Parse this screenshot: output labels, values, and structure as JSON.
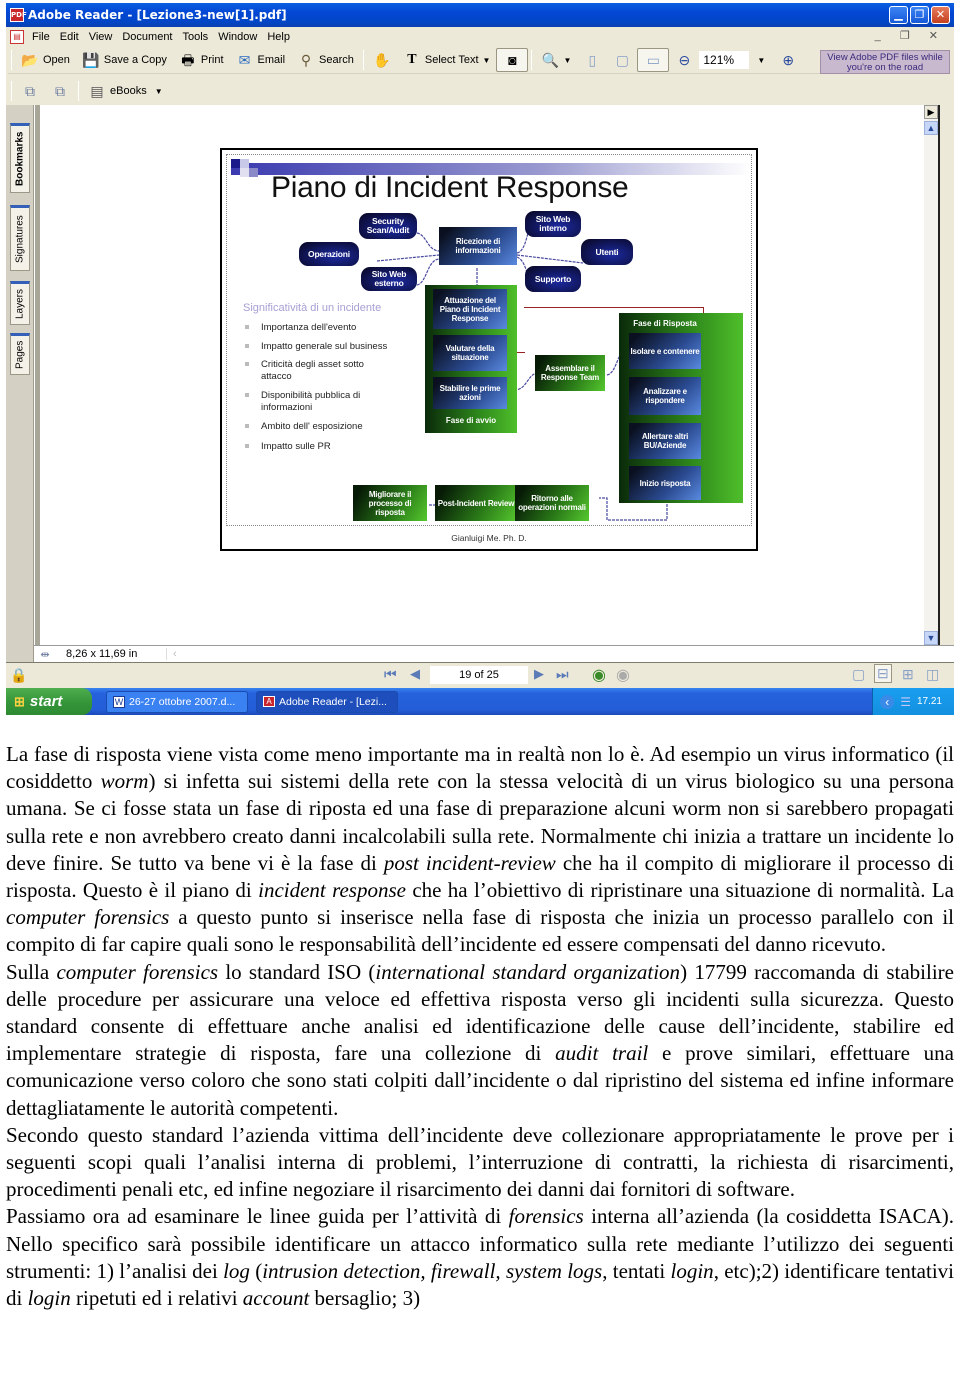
{
  "window": {
    "title": "Adobe Reader - [Lezione3-new[1].pdf]",
    "app_icon": "adobe-reader-icon",
    "controls": [
      "minimize",
      "restore",
      "close"
    ]
  },
  "menu": {
    "items": [
      "File",
      "Edit",
      "View",
      "Document",
      "Tools",
      "Window",
      "Help"
    ],
    "doc_controls": [
      "_",
      "❐",
      "✕"
    ]
  },
  "toolbar": {
    "open": "Open",
    "save_copy": "Save a Copy",
    "print": "Print",
    "email": "Email",
    "search": "Search",
    "select_text": "Select Text",
    "zoom_value": "121%",
    "ebooks": "eBooks",
    "promo": "View Adobe PDF files while you're on the road"
  },
  "nav_tabs": [
    "Bookmarks",
    "Signatures",
    "Layers",
    "Pages"
  ],
  "status": {
    "page_size": "8,26 x 11,69 in",
    "page_indicator": "19 of 25"
  },
  "taskbar": {
    "start": "start",
    "tasks": [
      {
        "label": "26-27 ottobre 2007.d...",
        "icon": "word-doc-icon",
        "active": false
      },
      {
        "label": "Adobe Reader - [Lezi...",
        "icon": "adobe-reader-icon",
        "active": true
      }
    ],
    "clock": "17.21"
  },
  "slide": {
    "title": "Piano di Incident Response",
    "sources": [
      "Security Scan/Audit",
      "Operazioni",
      "Sito Web esterno",
      "Sito Web interno",
      "Utenti",
      "Supporto"
    ],
    "hub": "Ricezione di informazioni",
    "avvio_panel": {
      "title": "Fase di avvio",
      "steps": [
        "Attuazione del Piano di Incident Response",
        "Valutare della situazione",
        "Stabilire le prime azioni"
      ]
    },
    "assemble": "Assemblare il Response Team",
    "risposta_panel": {
      "title": "Fase di Risposta",
      "steps": [
        "Isolare e contenere",
        "Analizzare e rispondere",
        "Allertare altri BU/Aziende",
        "Inizio risposta"
      ]
    },
    "post_steps": [
      "Migliorare il processo di risposta",
      "Post-Incident Review",
      "Ritorno alle operazioni normali"
    ],
    "significance_title": "Significatività di un incidente",
    "significance_items": [
      "Importanza dell'evento",
      "Impatto generale sul business",
      "Criticità degli asset sotto attacco",
      "Disponibilità pubblica di informazioni",
      "Ambito dell' esposizione",
      "Impatto sulle PR"
    ],
    "author": "Gianluigi Me. Ph. D."
  },
  "body": {
    "p1": [
      {
        "t": "La fase di risposta viene vista come meno importante ma in realtà non lo è. Ad esempio un virus informatico (il cosiddetto "
      },
      {
        "t": "worm",
        "i": true
      },
      {
        "t": ") si infetta sui sistemi della rete con la stessa velocità di un virus biologico su una persona umana. Se ci fosse stata un fase di riposta ed una fase di preparazione alcuni worm non si sarebbero propagati sulla rete e non avrebbero creato danni incalcolabili sulla rete. Normalmente chi inizia a trattare un incidente lo deve finire. Se tutto va bene vi è la fase di "
      },
      {
        "t": "post incident-review",
        "i": true
      },
      {
        "t": " che ha il compito di migliorare il processo di risposta. Questo è il piano di "
      },
      {
        "t": "incident response",
        "i": true
      },
      {
        "t": " che ha l’obiettivo di ripristinare una situazione di normalità. La "
      },
      {
        "t": "computer forensics",
        "i": true
      },
      {
        "t": " a questo punto si inserisce nella fase di risposta che inizia un processo parallelo con il compito di far capire quali sono le responsabilità dell’incidente ed essere compensati del danno ricevuto."
      }
    ],
    "p2": [
      {
        "t": "Sulla "
      },
      {
        "t": "computer forensics",
        "i": true
      },
      {
        "t": " lo standard ISO ("
      },
      {
        "t": "international standard organization",
        "i": true
      },
      {
        "t": ") 17799 raccomanda di stabilire delle procedure per assicurare una veloce ed effettiva risposta verso gli incidenti sulla sicurezza. Questo standard consente di effettuare anche analisi ed identificazione delle cause dell’incidente, stabilire ed implementare strategie di risposta, fare una collezione di "
      },
      {
        "t": "audit trail",
        "i": true
      },
      {
        "t": " e prove similari, effettuare una comunicazione verso coloro che sono stati colpiti dall’incidente o dal ripristino del sistema ed infine informare dettagliatamente le autorità competenti."
      }
    ],
    "p3": [
      {
        "t": "Secondo questo standard l’azienda vittima dell’incidente deve collezionare appropriatamente le prove per i seguenti scopi quali l’analisi interna di problemi, l’interruzione di contratti, la richiesta di risarcimenti, procedimenti penali etc, ed infine negoziare il risarcimento dei danni dai fornitori di software."
      }
    ],
    "p4": [
      {
        "t": "Passiamo ora ad esaminare le linee guida per l’attività di "
      },
      {
        "t": "forensics",
        "i": true
      },
      {
        "t": " interna all’azienda (la cosiddetta ISACA). Nello specifico sarà possibile identificare un attacco informatico sulla rete mediante l’utilizzo dei seguenti strumenti: 1) l’analisi dei "
      },
      {
        "t": "log",
        "i": true
      },
      {
        "t": " ("
      },
      {
        "t": "intrusion detection, firewall, system logs",
        "i": true
      },
      {
        "t": ", tentati "
      },
      {
        "t": "login",
        "i": true
      },
      {
        "t": ", etc);2) identificare tentativi di "
      },
      {
        "t": "login",
        "i": true
      },
      {
        "t": " ripetuti ed i relativi "
      },
      {
        "t": "account",
        "i": true
      },
      {
        "t": " bersaglio; 3)"
      }
    ]
  }
}
